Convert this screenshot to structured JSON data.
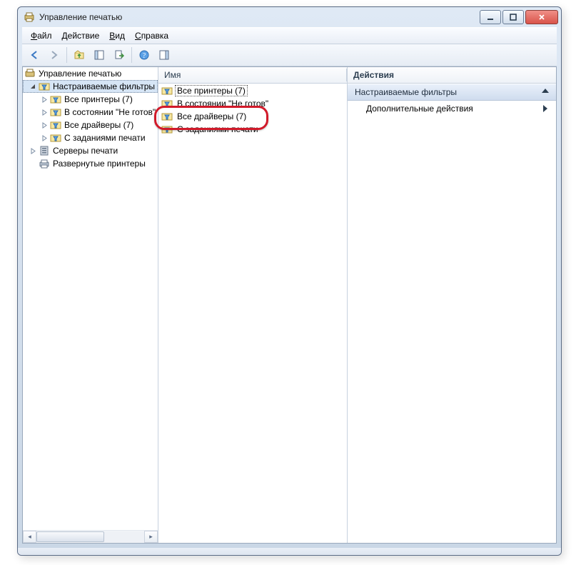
{
  "window": {
    "title": "Управление печатью"
  },
  "menu": {
    "file": "Файл",
    "action": "Действие",
    "view": "Вид",
    "help": "Справка"
  },
  "tree": {
    "root": "Управление печатью",
    "filters": "Настраиваемые фильтры",
    "all_printers": "Все принтеры (7)",
    "not_ready": "В состоянии \"Не готов\"",
    "all_drivers": "Все драйверы (7)",
    "with_jobs": "С заданиями печати",
    "servers": "Серверы печати",
    "deployed": "Развернутые принтеры"
  },
  "list": {
    "header_name": "Имя",
    "items": {
      "all_printers": "Все принтеры (7)",
      "not_ready": "В состоянии \"Не готов\"",
      "all_drivers": "Все драйверы (7)",
      "with_jobs": "С заданиями печати"
    }
  },
  "actions": {
    "header": "Действия",
    "group": "Настраиваемые фильтры",
    "more": "Дополнительные действия"
  }
}
